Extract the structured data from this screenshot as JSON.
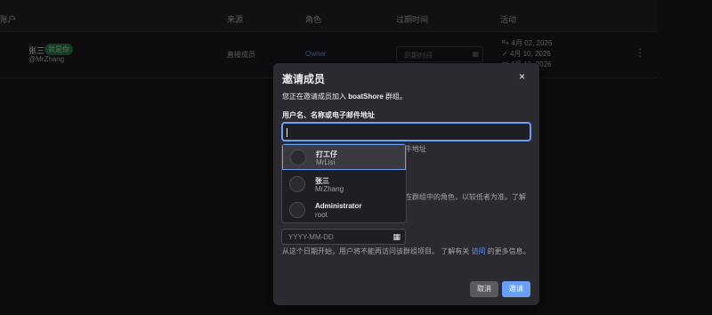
{
  "table": {
    "headers": [
      "账户",
      "来源",
      "角色",
      "过期时间",
      "活动"
    ],
    "row": {
      "name": "张三",
      "badge": "就是你",
      "username": "@MrZhang",
      "source": "直接成员",
      "role": "Owner",
      "expiry_placeholder": "到期时间",
      "activity": [
        "4月 02, 2026",
        "4月 10, 2026",
        "4月 10, 2026"
      ],
      "activity_icons": [
        "user-plus-icon",
        "check-icon",
        "calendar-icon"
      ]
    }
  },
  "modal": {
    "title": "邀请成员",
    "close": "×",
    "intro_prefix": "您正在邀请成员加入 ",
    "group": "boatShore",
    "intro_suffix": " 群组。",
    "field_label": "用户名、名称或电子邮件地址",
    "search_value": "",
    "partial_hint": "牛地址",
    "partial_role": "在群组中的角色，以较低者为准。了解",
    "date_placeholder": "YYYY-MM-DD",
    "help_prefix": "从这个日期开始，用户将不能再访问该群组项目。 了解有关 ",
    "help_link": "访问",
    "help_suffix": " 的更多信息。",
    "cancel": "取消",
    "invite": "邀请"
  },
  "dropdown": {
    "options": [
      {
        "name": "打工仔",
        "username": "MrLisi"
      },
      {
        "name": "张三",
        "username": "MrZhang"
      },
      {
        "name": "Administrator",
        "username": "root"
      }
    ]
  }
}
